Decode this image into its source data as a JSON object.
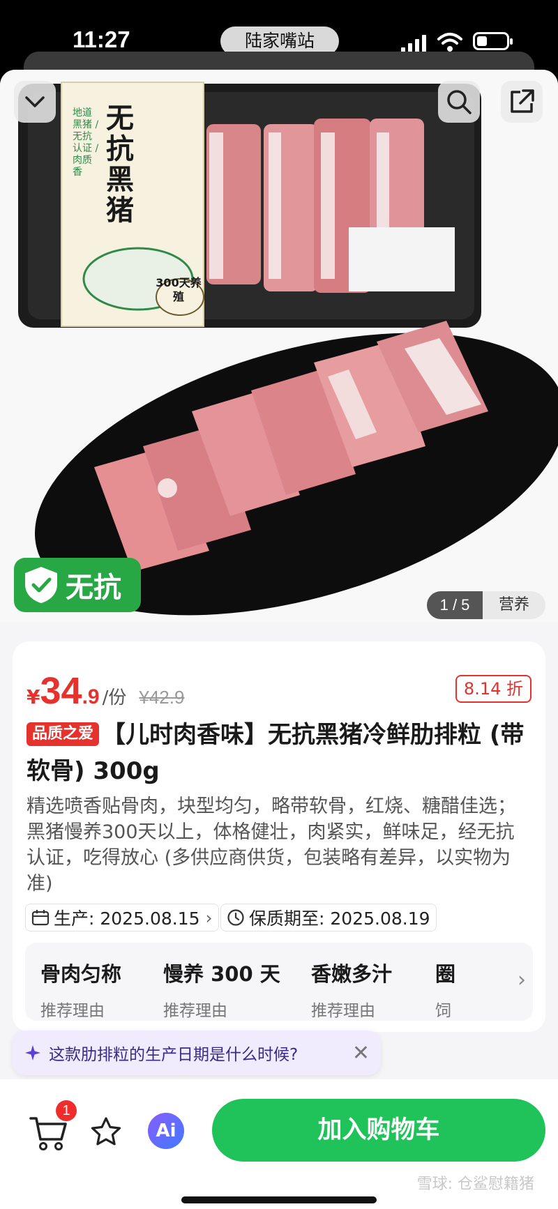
{
  "status_bar": {
    "time": "11:27",
    "location": "陆家嘴站"
  },
  "hero": {
    "image_counter": "1 / 5",
    "image_tab": "营养",
    "badge": "无抗",
    "package": {
      "brand_text": "无抗黑猪",
      "side_text": "地道黑猪 / 无抗认证 / 肉质香",
      "days_text": "300天养殖"
    }
  },
  "product": {
    "currency": "¥",
    "price_int": "34",
    "price_dec": ".9",
    "unit": "/份",
    "original_price": "¥42.9",
    "discount": "8.14 折",
    "tag": "品质之爱",
    "title": "【儿时肉香味】无抗黑猪冷鲜肋排粒 (带软骨) 300g",
    "description": "精选喷香贴骨肉，块型均匀，略带软骨，红烧、糖醋佳选；黑猪慢养300天以上，体格健壮，肉紧实，鲜味足，经无抗认证，吃得放心 (多供应商供货，包装略有差异，以实物为准)",
    "production_date": "生产: 2025.08.15",
    "expiry_date": "保质期至: 2025.08.19"
  },
  "features": [
    {
      "name": "骨肉匀称",
      "sub": "推荐理由"
    },
    {
      "name": "慢养 300 天",
      "sub": "推荐理由"
    },
    {
      "name": "香嫩多汁",
      "sub": "推荐理由"
    },
    {
      "name": "圈",
      "sub": "饲"
    }
  ],
  "ai_suggestion": "这款肋排粒的生产日期是什么时候?",
  "bottom": {
    "cart_count": "1",
    "ai_label": "Ai",
    "add_to_cart": "加入购物车",
    "watermark": "雪球: 仓鲨慰籍猪"
  },
  "colors": {
    "accent": "#e5322d",
    "primary_green": "#1fc35a"
  }
}
